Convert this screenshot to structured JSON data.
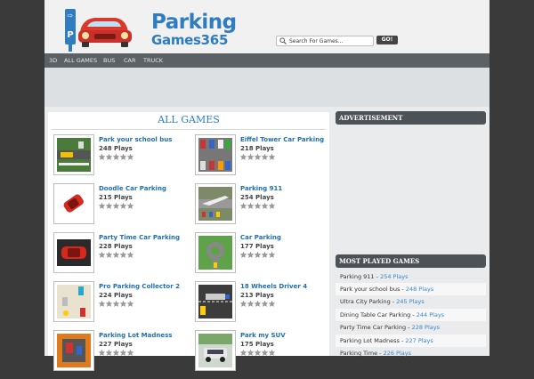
{
  "site": {
    "logo_word1": "Parking",
    "logo_word2": "Games365"
  },
  "search": {
    "placeholder": "Search For Games...",
    "value": "Search For Games...",
    "go_label": "GO!"
  },
  "nav": {
    "items": [
      "3D",
      "ALL GAMES",
      "BUS",
      "CAR",
      "TRUCK"
    ]
  },
  "main": {
    "title": "ALL GAMES",
    "games": [
      {
        "name": "Park your school bus",
        "plays": "248 Plays",
        "icon": "school-bus-parking-thumb"
      },
      {
        "name": "Eiffel Tower Car Parking",
        "plays": "218 Plays",
        "icon": "parking-lot-thumb"
      },
      {
        "name": "Doodle Car Parking",
        "plays": "215 Plays",
        "icon": "red-car-thumb"
      },
      {
        "name": "Parking 911",
        "plays": "254 Plays",
        "icon": "airport-parking-thumb"
      },
      {
        "name": "Party Time Car Parking",
        "plays": "228 Plays",
        "icon": "red-sports-car-thumb"
      },
      {
        "name": "Car Parking",
        "plays": "177 Plays",
        "icon": "roundabout-thumb"
      },
      {
        "name": "Pro Parking Collector 2",
        "plays": "224 Plays",
        "icon": "collector-thumb"
      },
      {
        "name": "18 Wheels Driver 4",
        "plays": "213 Plays",
        "icon": "truck-thumb"
      },
      {
        "name": "Parking Lot Madness",
        "plays": "227 Plays",
        "icon": "lot-madness-thumb"
      },
      {
        "name": "Park my SUV",
        "plays": "175 Plays",
        "icon": "suv-thumb"
      }
    ]
  },
  "sidebar": {
    "advertisement_title": "ADVERTISEMENT",
    "most_played_title": "MOST PLAYED GAMES",
    "most_played": [
      {
        "name": "Parking 911",
        "plays": "254 Plays"
      },
      {
        "name": "Park your school bus",
        "plays": "248 Plays"
      },
      {
        "name": "Ultra City Parking",
        "plays": "245 Plays"
      },
      {
        "name": "Dining Table Car Parking",
        "plays": "244 Plays"
      },
      {
        "name": "Party Time Car Parking",
        "plays": "228 Plays"
      },
      {
        "name": "Parking Lot Madness",
        "plays": "227 Plays"
      },
      {
        "name": "Parking Time",
        "plays": "226 Plays"
      }
    ]
  },
  "colors": {
    "brand_blue": "#2f7cc0",
    "link_blue": "#1f6fb5",
    "nav_bg": "#5c6166",
    "sidebar_head_bg": "#4d5257"
  }
}
